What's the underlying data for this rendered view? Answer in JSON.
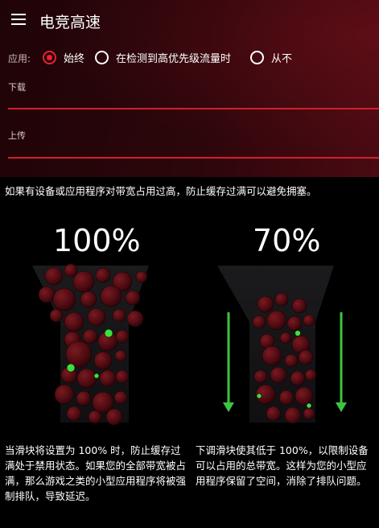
{
  "header": {
    "title": "电竞高速",
    "menu_icon": "hamburger-menu-icon"
  },
  "apply": {
    "label": "应用:",
    "options": [
      "始终",
      "在检测到高优先级流量时",
      "从不"
    ],
    "selected": "始终"
  },
  "fields": {
    "download_label": "下载",
    "upload_label": "上传"
  },
  "description": "如果有设备或应用程序对带宽占用过高，防止缓存过满可以避免拥塞。",
  "illustrations": {
    "left": {
      "percent": "100%",
      "caption": "当滑块将设置为 100% 时，防止缓存过满处于禁用状态。如果您的全部带宽被占满，那么游戏之类的小型应用程序将被强制排队，导致延迟。"
    },
    "right": {
      "percent": "70%",
      "caption": "下调滑块使其低于 100%，以限制设备可以占用的总带宽。这样为您的小型应用程序保留了空间，消除了排队问题。"
    }
  },
  "colors": {
    "accent": "#e8222f",
    "underline": "#d21f2a",
    "arrow": "#3ec53e",
    "green_packet": "#3ee03e",
    "bubble": "#6b1117"
  }
}
